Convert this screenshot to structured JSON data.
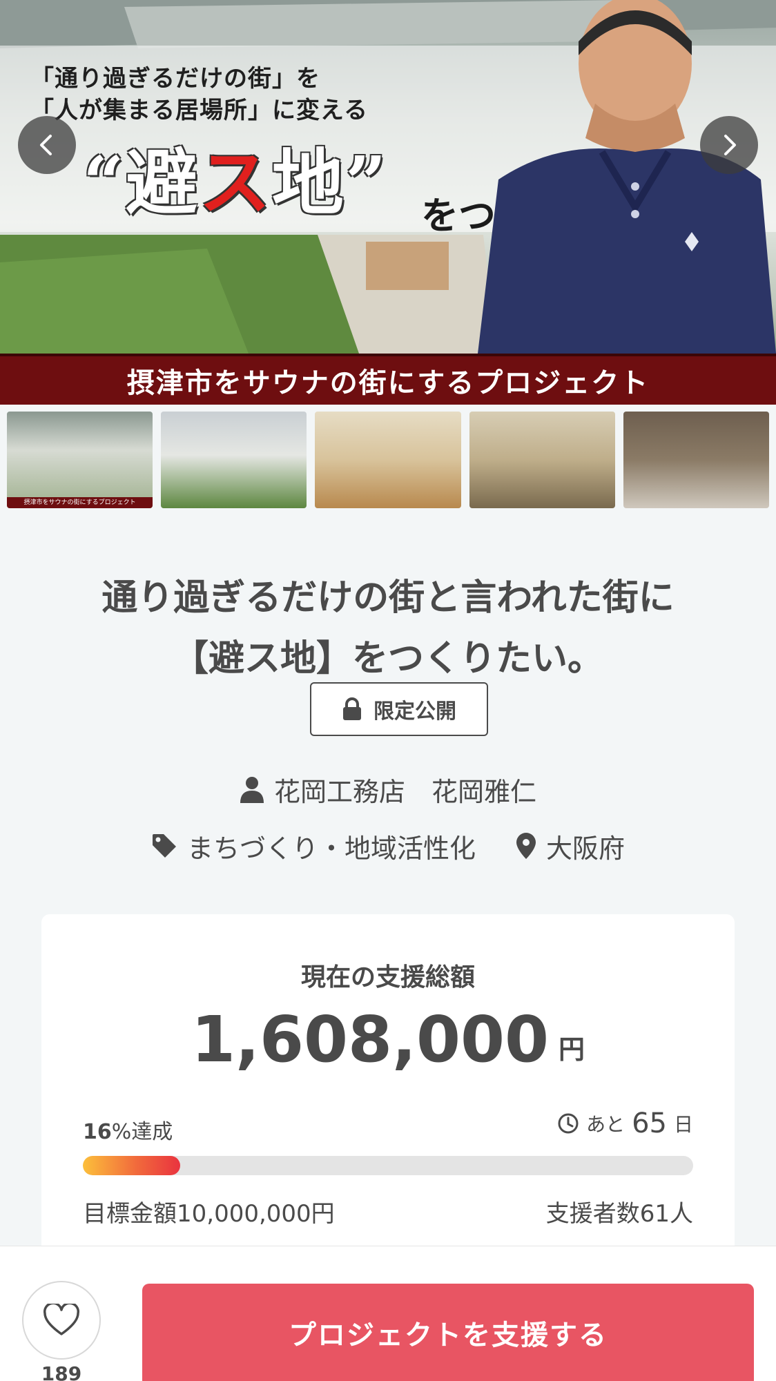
{
  "hero": {
    "line1": "「通り過ぎるだけの街」を",
    "line2": "「人が集まる居場所」に変える",
    "big_pre": "“避",
    "big_red": "ス",
    "big_post": "地”",
    "sub": "をつくりたい。",
    "strip": "摂津市をサウナの街にするプロジェクト"
  },
  "thumbnails": [
    {
      "caption": "摂津市をサウナの街にするプロジェクト"
    },
    {
      "caption": ""
    },
    {
      "caption": ""
    },
    {
      "caption": ""
    },
    {
      "caption": ""
    }
  ],
  "project": {
    "title_line1": "通り過ぎるだけの街と言われた街に",
    "title_line2": "【避ス地】をつくりたい。",
    "limited_label": "限定公開",
    "owner": "花岡工務店　花岡雅仁",
    "category": "まちづくり・地域活性化",
    "location": "大阪府"
  },
  "funding": {
    "label": "現在の支援総額",
    "amount": "1,608,000",
    "unit": "円",
    "percent": "16",
    "percent_suffix": "%達成",
    "remaining_prefix": "あと",
    "remaining_days": "65",
    "remaining_suffix": "日",
    "progress_fraction": 0.16,
    "goal": "目標金額10,000,000円",
    "supporters": "支援者数61人"
  },
  "bottom": {
    "favorite_count": "189",
    "support_label": "プロジェクトを支援する"
  },
  "colors": {
    "accent": "#e85563",
    "strip": "#6e0e10",
    "text": "#4a4a4a"
  }
}
